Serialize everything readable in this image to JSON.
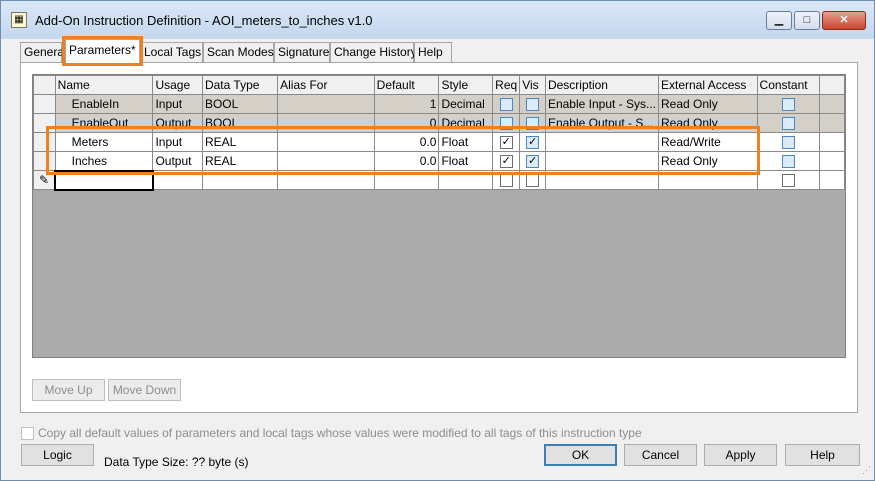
{
  "window": {
    "title": "Add-On Instruction Definition - AOI_meters_to_inches v1.0",
    "minimize_glyph": "▁",
    "maximize_glyph": "□",
    "close_glyph": "✕"
  },
  "tabs": [
    "Genera",
    "Parameters*",
    "Local Tags",
    "Scan Modes",
    "Signature",
    "Change History",
    "Help"
  ],
  "grid": {
    "columns": [
      "Name",
      "Usage",
      "Data Type",
      "Alias For",
      "Default",
      "Style",
      "Req",
      "Vis",
      "Description",
      "External Access",
      "Constant"
    ],
    "rows": [
      {
        "name": "EnableIn",
        "usage": "Input",
        "type": "BOOL",
        "alias": "",
        "default": "1",
        "style": "Decimal",
        "req": false,
        "vis": false,
        "desc": "Enable Input - Sys...",
        "access": "Read Only",
        "constant": false
      },
      {
        "name": "EnableOut",
        "usage": "Output",
        "type": "BOOL",
        "alias": "",
        "default": "0",
        "style": "Decimal",
        "req": false,
        "vis": false,
        "desc": "Enable Output - S...",
        "access": "Read Only",
        "constant": false
      },
      {
        "name": "Meters",
        "usage": "Input",
        "type": "REAL",
        "alias": "",
        "default": "0.0",
        "style": "Float",
        "req": true,
        "vis": true,
        "desc": "",
        "access": "Read/Write",
        "constant": false
      },
      {
        "name": "Inches",
        "usage": "Output",
        "type": "REAL",
        "alias": "",
        "default": "0.0",
        "style": "Float",
        "req": true,
        "vis": true,
        "desc": "",
        "access": "Read Only",
        "constant": false
      }
    ]
  },
  "buttons": {
    "move_up": "Move Up",
    "move_down": "Move Down",
    "logic": "Logic",
    "ok": "OK",
    "cancel": "Cancel",
    "apply": "Apply",
    "help": "Help"
  },
  "copy_defaults_label": "Copy all default values of parameters and local tags whose values were modified to all tags of this instruction type",
  "data_type_size": "Data Type Size: ?? byte (s)",
  "colors": {
    "highlight": "#f07f1e",
    "checkbox_blue": "#4a88c8"
  }
}
